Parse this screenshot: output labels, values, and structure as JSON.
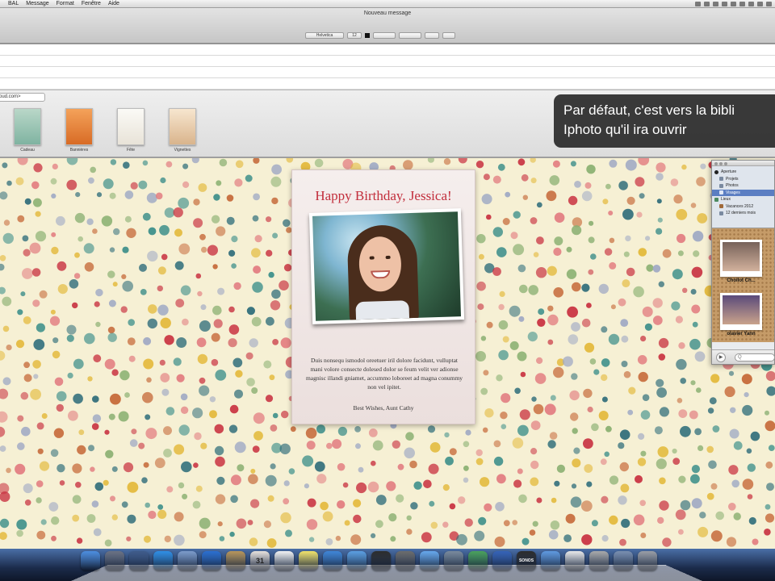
{
  "menubar": {
    "items": [
      "BAL",
      "Message",
      "Format",
      "Fenêtre",
      "Aide"
    ]
  },
  "window": {
    "title": "Nouveau message"
  },
  "format_toolbar": {
    "font": "Helvetica",
    "size": "12"
  },
  "header": {
    "from_value": "oud.com>"
  },
  "stationery": {
    "categories": [
      {
        "label": "Cadeau",
        "color": "#9fc6b4"
      },
      {
        "label": "Bannières",
        "color": "#e88b3e"
      },
      {
        "label": "Fête",
        "color": "#f4f1ea"
      },
      {
        "label": "Vignettes",
        "color": "#f0dcc3"
      }
    ]
  },
  "overlay": {
    "line1": "Par défaut, c'est vers la bibli",
    "line2": "Iphoto qu'il ira ouvrir"
  },
  "card": {
    "title": "Happy Birthday, Jessica!",
    "body": "Duis nonsequ ismodol oreetuer iril dolore facidunt, vulluptat mani volore consecte dolesed dolor se feum velit ver adionse magnisc illandi gniamet, accummo loboreet ad magna conummy non vel ipitet.",
    "signature": "Best Wishes, Aunt Cathy"
  },
  "media_browser": {
    "sources": [
      {
        "label": "Aperture",
        "selected": false
      },
      {
        "label": "Projets",
        "selected": false
      },
      {
        "label": "Photos",
        "selected": false
      },
      {
        "label": "Visages",
        "selected": true
      },
      {
        "label": "Lieux",
        "selected": false
      },
      {
        "label": "Vacances 2012",
        "selected": false
      },
      {
        "label": "12 derniers mois",
        "selected": false
      }
    ],
    "faces": [
      "Chollot Ch...",
      "olavier Yann"
    ],
    "search_placeholder": "Q"
  },
  "dock": {
    "apps": [
      {
        "name": "finder-icon",
        "color": "#4c8ee0"
      },
      {
        "name": "launchpad-icon",
        "color": "#6b7283"
      },
      {
        "name": "dashboard-icon",
        "color": "#3f5b8a"
      },
      {
        "name": "app-store-icon",
        "color": "#2f8fe6"
      },
      {
        "name": "mail-icon",
        "color": "#7d9ccb"
      },
      {
        "name": "safari-icon",
        "color": "#2a6fd1"
      },
      {
        "name": "contacts-icon",
        "color": "#b8965a"
      },
      {
        "name": "calendar-icon",
        "color": "#e9e2dc"
      },
      {
        "name": "reminders-icon",
        "color": "#f3f3f3"
      },
      {
        "name": "notes-icon",
        "color": "#f2e36a"
      },
      {
        "name": "itunes-icon",
        "color": "#3f86d8"
      },
      {
        "name": "safari-alt-icon",
        "color": "#5b9fe2"
      },
      {
        "name": "aperture-icon",
        "color": "#2d2d2d"
      },
      {
        "name": "photo-booth-icon",
        "color": "#6c6c6c"
      },
      {
        "name": "messages-icon",
        "color": "#67a8ec"
      },
      {
        "name": "preview-icon",
        "color": "#7a8a9b"
      },
      {
        "name": "numbers-icon",
        "color": "#4aa25b"
      },
      {
        "name": "keynote-icon",
        "color": "#3563b8"
      },
      {
        "name": "sonos-icon",
        "color": "#2c2c2c"
      },
      {
        "name": "iphoto-icon",
        "color": "#5f9ae0"
      },
      {
        "name": "document-icon",
        "color": "#e9e9e9"
      },
      {
        "name": "photos-stack-icon",
        "color": "#a9a9a9"
      },
      {
        "name": "folder-icon",
        "color": "#7a8fb0"
      },
      {
        "name": "trash-icon",
        "color": "#9a9ea5"
      }
    ],
    "calendar_day": "31",
    "sonos_label": "SONOS"
  },
  "theme": {
    "dot_colors": [
      "#c8303f",
      "#2f6d7a",
      "#e3b93b",
      "#8bb072",
      "#e27c80",
      "#9fa9c4",
      "#c66a3a",
      "#3d8f8a"
    ]
  }
}
